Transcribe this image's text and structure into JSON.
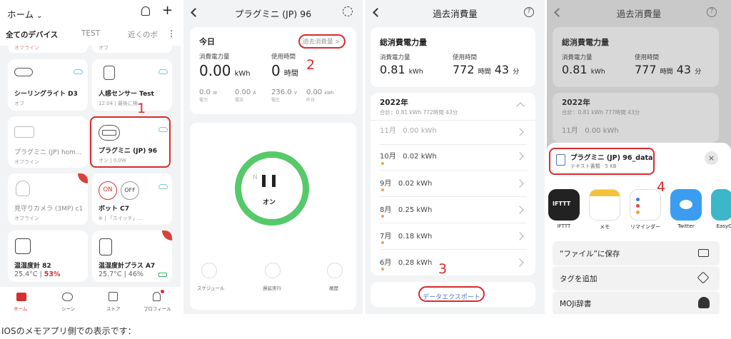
{
  "screen1": {
    "home_label": "ホーム",
    "tabs": [
      "全てのデバイス",
      "TEST",
      "近くのボ"
    ],
    "cut_labels": [
      "オフライン",
      "オフ"
    ],
    "devices": [
      {
        "name": "シーリングライト D3",
        "status": "オフ"
      },
      {
        "name": "人感センサー Test",
        "status": "12:04",
        "status2": "最後に検..."
      },
      {
        "name": "プラグミニ (JP) hom...",
        "status": "オフライン"
      },
      {
        "name": "プラグミニ (JP) 96",
        "status": "オン",
        "status2": "0.0W"
      },
      {
        "name": "見守りカメラ (3MP) c1",
        "status": "オフライン"
      },
      {
        "name": "ボット C7",
        "status": "⊕",
        "status2": "「スイッチ」..."
      },
      {
        "name": "温湿度計 82",
        "temp": "25.4°C",
        "hum": "53%"
      },
      {
        "name": "温湿度計プラス A7",
        "temp": "25.7°C",
        "hum": "46%"
      }
    ],
    "bot_on": "ON",
    "bot_off": "OFF",
    "nav": [
      "ホーム",
      "シーン",
      "ストア",
      "プロフィール"
    ]
  },
  "screen2": {
    "title": "プラグミニ (JP) 96",
    "today": "今日",
    "history_link": "過去消費量 >",
    "power_label": "消費電力量",
    "time_label": "使用時間",
    "power_value": "0.00",
    "power_unit": "kWh",
    "time_value": "0",
    "time_unit": "時間",
    "metrics": [
      {
        "value": "0.0",
        "unit": "W",
        "label": "電力"
      },
      {
        "value": "0.00",
        "unit": "A",
        "label": "電流"
      },
      {
        "value": "236.0",
        "unit": "V",
        "label": "電圧"
      },
      {
        "value": "0.00",
        "unit": "kWh",
        "label": "昨日"
      }
    ],
    "plug_n": "N",
    "switch_state": "オン",
    "actions": [
      "スケジュール",
      "遅延実行",
      "履歴"
    ]
  },
  "screen3": {
    "title": "過去消費量",
    "total_title": "総消費電力量",
    "power_label": "消費電力量",
    "time_label": "使用時間",
    "power_value": "0.81",
    "power_unit": "kWh",
    "hours": "772",
    "hours_unit": "時間",
    "mins": "43",
    "mins_unit": "分",
    "year": "2022年",
    "year_summary": "合計：0.81 kWh  772時間 43分",
    "months": [
      {
        "m": "11月",
        "v": "0.00 kWh"
      },
      {
        "m": "10月",
        "v": "0.02 kWh"
      },
      {
        "m": "9月",
        "v": "0.02 kWh"
      },
      {
        "m": "8月",
        "v": "0.25 kWh"
      },
      {
        "m": "7月",
        "v": "0.18 kWh"
      },
      {
        "m": "6月",
        "v": "0.28 kWh"
      }
    ],
    "export": "データエクスポート"
  },
  "screen4": {
    "title": "過去消費量",
    "total_title": "総消費電力量",
    "power_label": "消費電力量",
    "time_label": "使用時間",
    "power_value": "0.81",
    "power_unit": "kWh",
    "hours": "777",
    "hours_unit": "時間",
    "mins": "43",
    "mins_unit": "分",
    "year": "2022年",
    "year_summary": "合計：0.81 kWh  777時間 43分",
    "month": "11月",
    "month_value": "0.00 kWh",
    "file_name": "プラグミニ (JP) 96_data",
    "file_meta": "テキスト書類 · 5 KB",
    "apps": [
      "IFTTT",
      "メモ",
      "リマインダー",
      "Twitter",
      "EasyC"
    ],
    "ifttt_logo": "IFTTT",
    "actions": [
      "“ファイル”に保存",
      "タグを追加",
      "MOJi辞書"
    ]
  },
  "callouts": [
    "1",
    "2",
    "3",
    "4"
  ],
  "caption": "IOSのメモアプリ側での表示です："
}
